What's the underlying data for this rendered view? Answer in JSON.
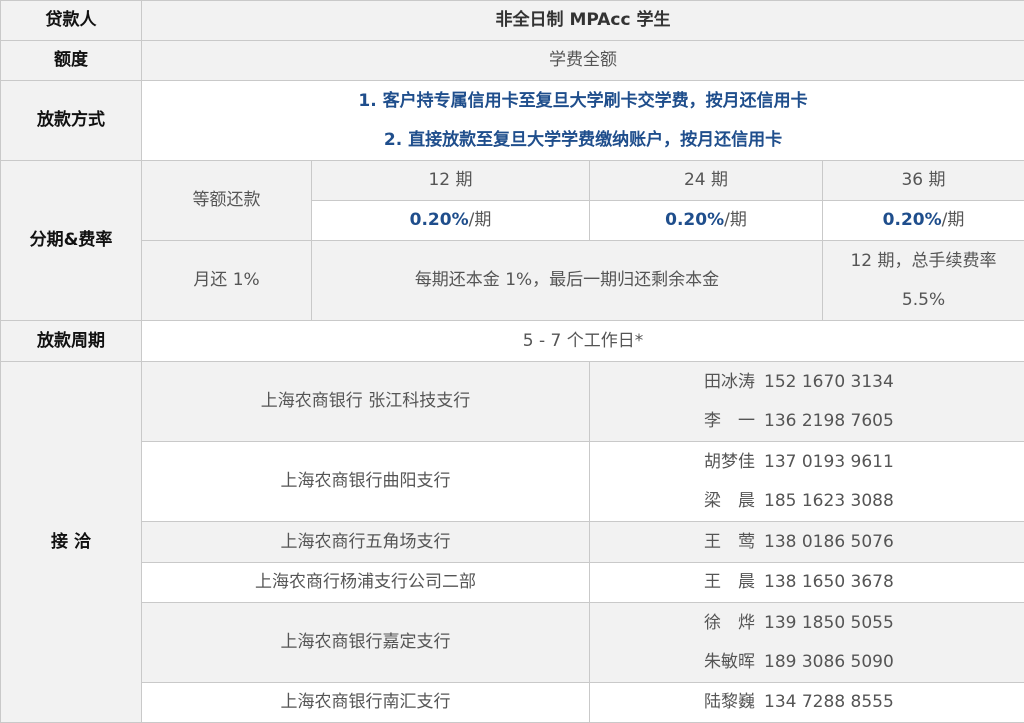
{
  "rows": {
    "lender": {
      "label": "贷款人",
      "value": "非全日制 MPAcc 学生"
    },
    "amount": {
      "label": "额度",
      "value": "学费全额"
    },
    "method": {
      "label": "放款方式",
      "lines": [
        "1. 客户持专属信用卡至复旦大学刷卡交学费，按月还信用卡",
        "2. 直接放款至复旦大学学费缴纳账户，按月还信用卡"
      ]
    },
    "installment": {
      "label": "分期&费率",
      "repayment_type": "等额还款",
      "terms": [
        "12 期",
        "24 期",
        "36 期"
      ],
      "rate": "0.20%",
      "rate_unit": "/期",
      "monthly_label": "月还 1%",
      "monthly_desc": "每期还本金 1%，最后一期归还剩余本金",
      "total_fee_line1": "12 期，总手续费率",
      "total_fee_line2": "5.5%"
    },
    "period": {
      "label": "放款周期",
      "value": "5 - 7 个工作日*"
    },
    "contact": {
      "label": "接 洽",
      "branches": [
        {
          "name": "上海农商银行 张江科技支行",
          "people": [
            {
              "name": "田冰涛",
              "phone": "152 1670 3134"
            },
            {
              "name": "李　一",
              "phone": "136 2198 7605"
            }
          ]
        },
        {
          "name": "上海农商银行曲阳支行",
          "people": [
            {
              "name": "胡梦佳",
              "phone": "137 0193 9611"
            },
            {
              "name": "梁　晨",
              "phone": "185 1623 3088"
            }
          ]
        },
        {
          "name": "上海农商行五角场支行",
          "people": [
            {
              "name": "王　莺",
              "phone": "138 0186 5076"
            }
          ]
        },
        {
          "name": "上海农商行杨浦支行公司二部",
          "people": [
            {
              "name": "王　晨",
              "phone": "138 1650 3678"
            }
          ]
        },
        {
          "name": "上海农商银行嘉定支行",
          "people": [
            {
              "name": "徐　烨",
              "phone": "139 1850 5055"
            },
            {
              "name": "朱敏晖",
              "phone": "189 3086 5090"
            }
          ]
        },
        {
          "name": "上海农商银行南汇支行",
          "people": [
            {
              "name": "陆黎巍",
              "phone": "134 7288 8555"
            }
          ]
        }
      ]
    }
  },
  "colors": {
    "header_bg": "#f2f2f2",
    "border": "#c9c9c9",
    "blue": "#1f4e8c",
    "text": "#555555"
  }
}
